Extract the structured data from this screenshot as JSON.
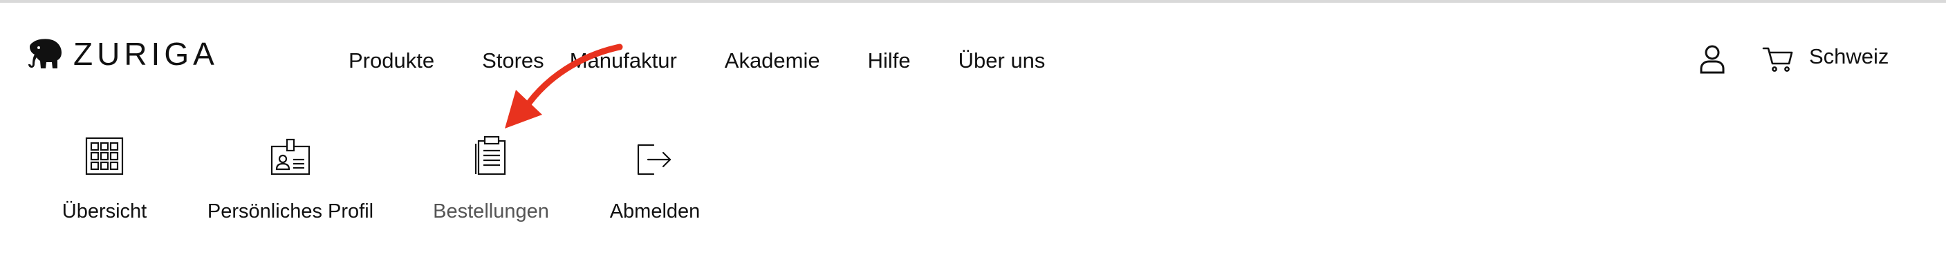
{
  "brand": {
    "name": "ZURIGA",
    "logo_icon": "elephant-icon"
  },
  "nav": {
    "items": [
      {
        "label": "Produkte"
      },
      {
        "label": "Stores"
      },
      {
        "label": "Manufaktur"
      },
      {
        "label": "Akademie"
      },
      {
        "label": "Hilfe"
      },
      {
        "label": "Über uns"
      }
    ]
  },
  "header_actions": {
    "user_icon": "user-icon",
    "cart_icon": "cart-icon",
    "region_label": "Schweiz"
  },
  "account_tabs": {
    "active": "Bestellungen",
    "items": [
      {
        "label": "Übersicht",
        "icon": "grid-icon"
      },
      {
        "label": "Persönliches Profil",
        "icon": "id-badge-icon"
      },
      {
        "label": "Bestellungen",
        "icon": "clipboard-icon"
      },
      {
        "label": "Abmelden",
        "icon": "logout-icon"
      }
    ]
  },
  "annotation": {
    "arrow_color": "#e8321e"
  },
  "colors": {
    "text": "#111111",
    "active_tab_text": "#555555",
    "background": "#ffffff",
    "top_rule": "#d9d9d9"
  }
}
